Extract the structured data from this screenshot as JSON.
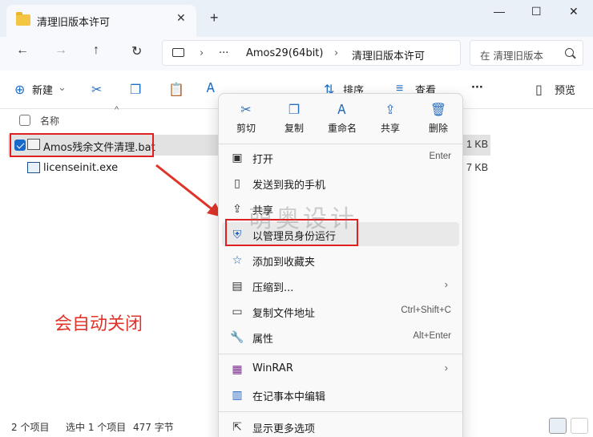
{
  "window": {
    "tab_title": "清理旧版本许可",
    "new_tab": "+",
    "minimize": "—",
    "maximize": "☐",
    "close": "✕"
  },
  "address": {
    "ellipsis": "···",
    "segment1": "Amos29(64bit)",
    "segment2": "清理旧版本许可",
    "search_placeholder": "在 清理旧版本"
  },
  "nav": {
    "back": "←",
    "forward": "→",
    "up": "↑",
    "refresh": "↻"
  },
  "toolbar": {
    "new_label": "新建",
    "sort_label": "排序",
    "view_label": "查看",
    "more": "···",
    "preview_label": "预览"
  },
  "list": {
    "name_header": "名称",
    "files": [
      {
        "name": "Amos残余文件清理.bat",
        "size": "1 KB"
      },
      {
        "name": "licenseinit.exe",
        "size": "7 KB"
      }
    ]
  },
  "annotation": "会自动关闭",
  "watermark": "萌奥设计",
  "status": {
    "count": "2 个项目",
    "selected": "选中 1 个项目",
    "size": "477 字节"
  },
  "context_menu": {
    "quick_actions": [
      {
        "label": "剪切",
        "icon": "cut-icon",
        "glyph": "✂"
      },
      {
        "label": "复制",
        "icon": "copy-icon",
        "glyph": "❐"
      },
      {
        "label": "重命名",
        "icon": "rename-icon",
        "glyph": "Ꭺ"
      },
      {
        "label": "共享",
        "icon": "share-icon",
        "glyph": "⇪"
      },
      {
        "label": "删除",
        "icon": "trash-icon",
        "glyph": "🗑"
      }
    ],
    "items": [
      {
        "label": "打开",
        "shortcut": "Enter",
        "icon": "open-icon"
      },
      {
        "label": "发送到我的手机",
        "shortcut": "",
        "icon": "phone-icon"
      },
      {
        "label": "共享",
        "shortcut": "",
        "icon": "share-icon"
      },
      {
        "label": "以管理员身份运行",
        "shortcut": "",
        "icon": "shield-icon"
      },
      {
        "label": "添加到收藏夹",
        "shortcut": "",
        "icon": "star-icon"
      },
      {
        "label": "压缩到...",
        "shortcut": "",
        "icon": "zip-icon"
      },
      {
        "label": "复制文件地址",
        "shortcut": "Ctrl+Shift+C",
        "icon": "path-icon"
      },
      {
        "label": "属性",
        "shortcut": "Alt+Enter",
        "icon": "wrench-icon"
      },
      {
        "label": "WinRAR",
        "shortcut": "",
        "icon": "winrar-icon"
      },
      {
        "label": "在记事本中编辑",
        "shortcut": "",
        "icon": "notepad-icon"
      },
      {
        "label": "显示更多选项",
        "shortcut": "",
        "icon": "more-options-icon"
      }
    ]
  },
  "colors": {
    "accent": "#1868c9",
    "annotation": "#e0342a",
    "highlight_box": "#e02020"
  }
}
